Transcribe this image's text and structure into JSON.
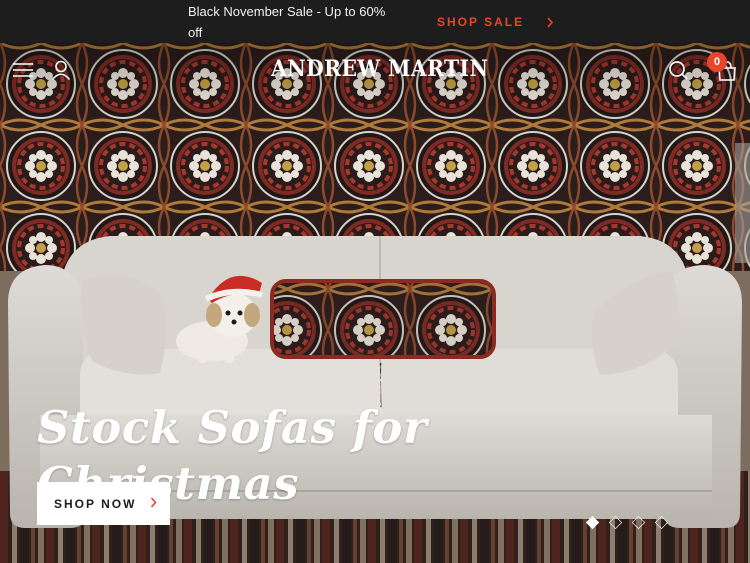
{
  "announcement": {
    "text": "Black November Sale - Up to 60% off",
    "cta_label": "SHOP SALE",
    "cta_color": "#e8452c"
  },
  "header": {
    "logo_text": "ANDREW MARTIN",
    "cart_count": "0",
    "icons": [
      "menu-icon",
      "account-icon",
      "search-icon",
      "cart-icon"
    ]
  },
  "hero": {
    "headline": "Stock Sofas for Christmas",
    "button_label": "SHOP NOW",
    "slides_total": 4,
    "active_slide": 1
  },
  "colors": {
    "bar_bg": "#1e1d1d",
    "accent": "#e8452c",
    "white": "#ffffff"
  }
}
